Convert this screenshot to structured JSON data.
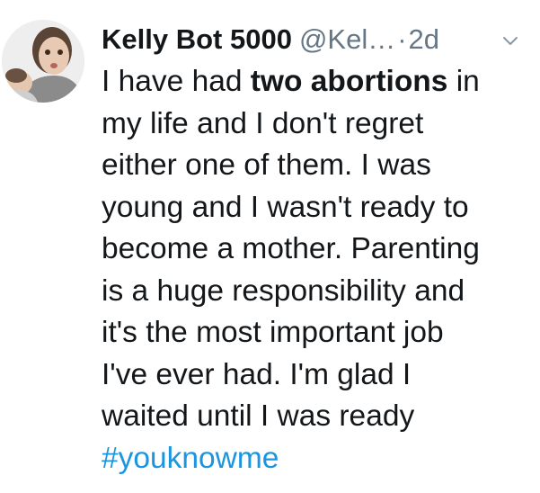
{
  "tweet": {
    "author_name": "Kelly Bot 5000",
    "handle": "@Kel…",
    "separator": "·",
    "time": "2d",
    "avatar_icon": "user-avatar",
    "more_icon": "chevron-down-icon",
    "text_lines": [
      {
        "pre": "I have had ",
        "bold": "two abortions",
        "post": " in"
      },
      {
        "text": "my life and I don't regret"
      },
      {
        "text": "either one of them. I was"
      },
      {
        "text": "young and I wasn't ready to"
      },
      {
        "text": "become a mother. Parenting"
      },
      {
        "text": "is a huge responsibility and"
      },
      {
        "text": "it's the most important job"
      },
      {
        "text": "I've ever had. I'm glad I"
      },
      {
        "text": "waited until I was ready"
      }
    ],
    "hashtag": "#youknowme",
    "colors": {
      "text": "#14171a",
      "secondary": "#657786",
      "link": "#1b95e0"
    }
  }
}
